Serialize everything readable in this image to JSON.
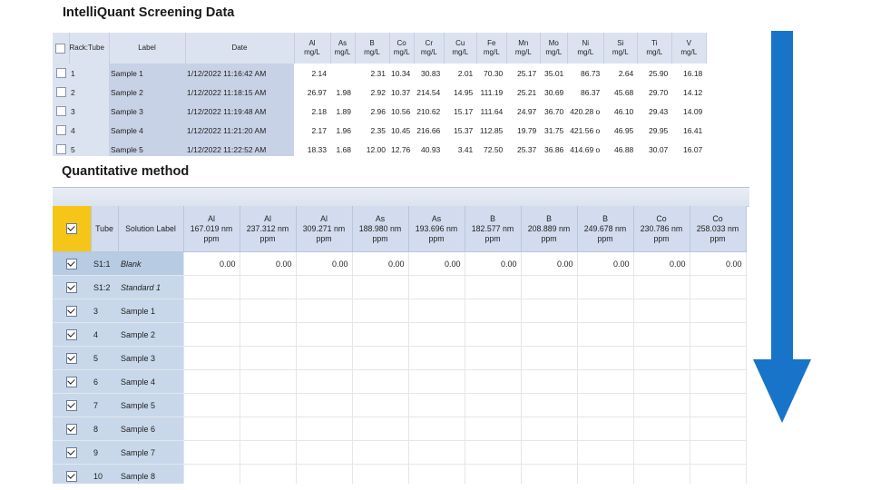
{
  "screening": {
    "title": "IntelliQuant Screening Data",
    "headers": {
      "rack_tube": "Rack:Tube",
      "label": "Label",
      "date": "Date",
      "unit": "mg/L",
      "elements": [
        "Al",
        "As",
        "B",
        "Co",
        "Cr",
        "Cu",
        "Fe",
        "Mn",
        "Mo",
        "Ni",
        "Si",
        "Ti",
        "V"
      ]
    },
    "rows": [
      {
        "tube": "1",
        "label": "Sample 1",
        "date": "1/12/2022 11:16:42 AM",
        "values": [
          "2.14",
          "",
          "2.31",
          "10.34",
          "30.83",
          "2.01",
          "70.30",
          "25.17",
          "35.01",
          "86.73",
          "2.64",
          "25.90",
          "16.18"
        ]
      },
      {
        "tube": "2",
        "label": "Sample 2",
        "date": "1/12/2022 11:18:15 AM",
        "values": [
          "26.97",
          "1.98",
          "2.92",
          "10.37",
          "214.54",
          "14.95",
          "111.19",
          "25.21",
          "30.69",
          "86.37",
          "45.68",
          "29.70",
          "14.12"
        ]
      },
      {
        "tube": "3",
        "label": "Sample 3",
        "date": "1/12/2022 11:19:48 AM",
        "values": [
          "2.18",
          "1.89",
          "2.96",
          "10.56",
          "210.62",
          "15.17",
          "111.64",
          "24.97",
          "36.70",
          "420.28 o",
          "46.10",
          "29.43",
          "14.09"
        ]
      },
      {
        "tube": "4",
        "label": "Sample 4",
        "date": "1/12/2022 11:21:20 AM",
        "values": [
          "2.17",
          "1.96",
          "2.35",
          "10.45",
          "216.66",
          "15.37",
          "112.85",
          "19.79",
          "31.75",
          "421.56 o",
          "46.95",
          "29.95",
          "16.41"
        ]
      },
      {
        "tube": "5",
        "label": "Sample 5",
        "date": "1/12/2022 11:22:52 AM",
        "values": [
          "18.33",
          "1.68",
          "12.00",
          "12.76",
          "40.93",
          "3.41",
          "72.50",
          "25.37",
          "36.86",
          "414.69 o",
          "46.88",
          "30.07",
          "16.07"
        ]
      }
    ]
  },
  "quant": {
    "title": "Quantitative method",
    "headers": {
      "tube": "Tube",
      "solution_label": "Solution Label",
      "unit": "ppm",
      "lines": [
        {
          "el": "Al",
          "wl": "167.019 nm"
        },
        {
          "el": "Al",
          "wl": "237.312 nm"
        },
        {
          "el": "Al",
          "wl": "309.271 nm"
        },
        {
          "el": "As",
          "wl": "188.980 nm"
        },
        {
          "el": "As",
          "wl": "193.696 nm"
        },
        {
          "el": "B",
          "wl": "182.577 nm"
        },
        {
          "el": "B",
          "wl": "208.889 nm"
        },
        {
          "el": "B",
          "wl": "249.678 nm"
        },
        {
          "el": "Co",
          "wl": "230.786 nm"
        },
        {
          "el": "Co",
          "wl": "258.033 nm"
        }
      ]
    },
    "header_checked": true,
    "rows": [
      {
        "checked": true,
        "tube": "S1:1",
        "label": "Blank",
        "italic": true,
        "values": [
          "0.00",
          "0.00",
          "0.00",
          "0.00",
          "0.00",
          "0.00",
          "0.00",
          "0.00",
          "0.00",
          "0.00"
        ]
      },
      {
        "checked": true,
        "tube": "S1:2",
        "label": "Standard 1",
        "italic": true,
        "values": []
      },
      {
        "checked": true,
        "tube": "3",
        "label": "Sample 1",
        "italic": false,
        "values": []
      },
      {
        "checked": true,
        "tube": "4",
        "label": "Sample 2",
        "italic": false,
        "values": []
      },
      {
        "checked": true,
        "tube": "5",
        "label": "Sample 3",
        "italic": false,
        "values": []
      },
      {
        "checked": true,
        "tube": "6",
        "label": "Sample 4",
        "italic": false,
        "values": []
      },
      {
        "checked": true,
        "tube": "7",
        "label": "Sample 5",
        "italic": false,
        "values": []
      },
      {
        "checked": true,
        "tube": "8",
        "label": "Sample 6",
        "italic": false,
        "values": []
      },
      {
        "checked": true,
        "tube": "9",
        "label": "Sample 7",
        "italic": false,
        "values": []
      },
      {
        "checked": true,
        "tube": "10",
        "label": "Sample 8",
        "italic": false,
        "values": []
      }
    ]
  },
  "arrow": {
    "icon": "down-arrow-icon",
    "color": "#1874c8"
  }
}
